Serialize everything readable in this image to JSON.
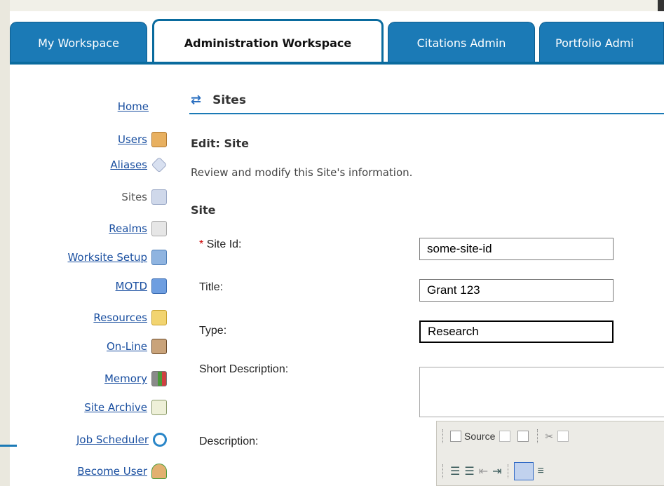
{
  "tabs": [
    {
      "label": "My Workspace",
      "active": false
    },
    {
      "label": "Administration Workspace",
      "active": true
    },
    {
      "label": "Citations Admin",
      "active": false
    },
    {
      "label": "Portfolio Admi",
      "active": false
    }
  ],
  "nav": {
    "items": [
      {
        "label": "Home",
        "icon": "none",
        "current": false
      },
      {
        "label": "Users",
        "icon": "users-icon",
        "current": false
      },
      {
        "label": "Aliases",
        "icon": "tag-icon",
        "current": false
      },
      {
        "label": "Sites",
        "icon": "sites-icon",
        "current": true
      },
      {
        "label": "Realms",
        "icon": "realms-icon",
        "current": false
      },
      {
        "label": "Worksite Setup",
        "icon": "worksite-icon",
        "current": false
      },
      {
        "label": "MOTD",
        "icon": "flag-icon",
        "current": false
      },
      {
        "label": "Resources",
        "icon": "folder-icon",
        "current": false
      },
      {
        "label": "On-Line",
        "icon": "contact-card-icon",
        "current": false
      },
      {
        "label": "Memory",
        "icon": "chart-icon",
        "current": false
      },
      {
        "label": "Site Archive",
        "icon": "archive-icon",
        "current": false
      },
      {
        "label": "Job Scheduler",
        "icon": "clock-icon",
        "current": false
      },
      {
        "label": "Become User",
        "icon": "become-user-icon",
        "current": false
      }
    ]
  },
  "main": {
    "tool_title": "Sites",
    "edit_title": "Edit: Site",
    "instructions": "Review and modify this Site's information.",
    "section": "Site",
    "fields": {
      "site_id": {
        "required_mark": "*",
        "label": "Site Id:",
        "value": "some-site-id"
      },
      "title": {
        "label": "Title:",
        "value": "Grant 123"
      },
      "type": {
        "label": "Type:",
        "value": "Research"
      },
      "short_description": {
        "label": "Short Description:",
        "value": ""
      },
      "description": {
        "label": "Description:"
      }
    }
  },
  "editor": {
    "source_label": "Source"
  },
  "colors": {
    "tab_blue": "#1b7ab6",
    "link": "#1a4fa0",
    "required": "#cc0000"
  }
}
